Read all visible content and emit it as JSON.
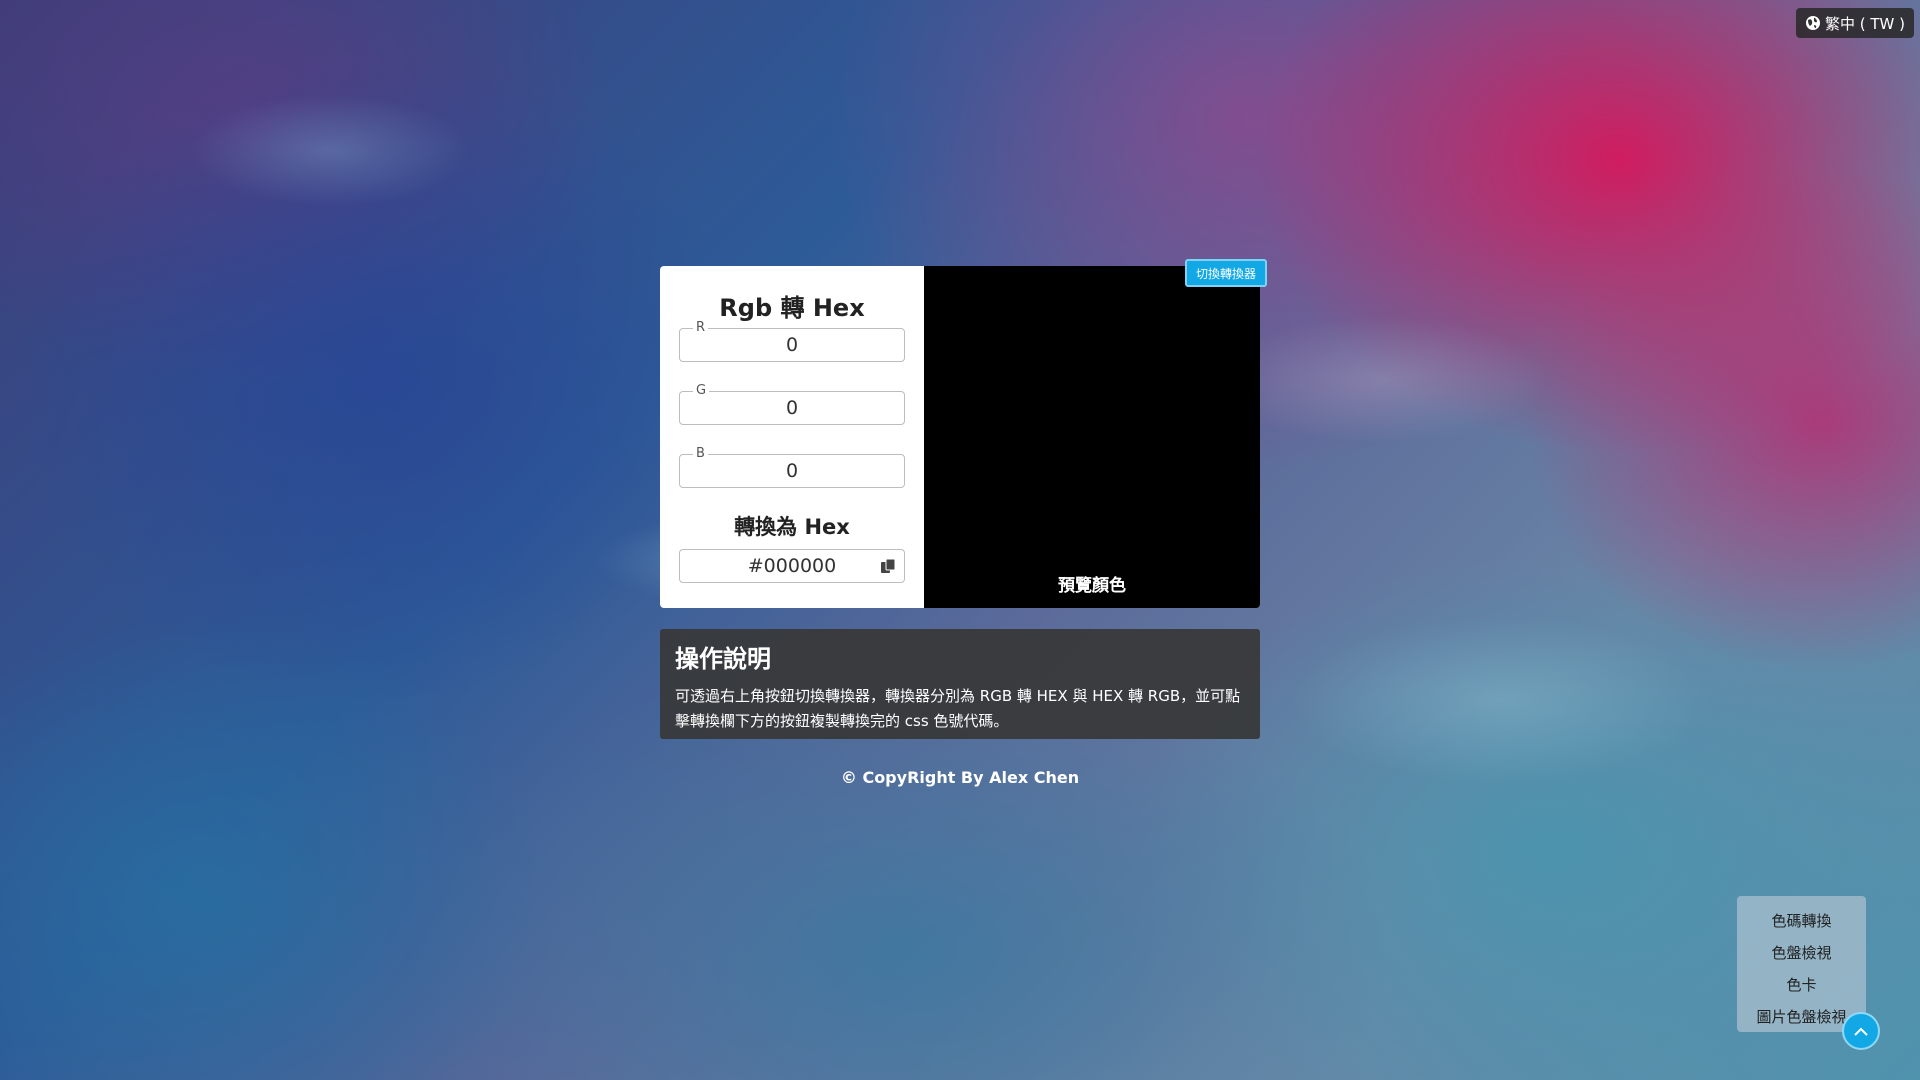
{
  "language": {
    "label": "繁中 ( TW )",
    "icon": "globe-icon"
  },
  "converter": {
    "title": "Rgb 轉 Hex",
    "fields": [
      {
        "label": "R",
        "value": "0"
      },
      {
        "label": "G",
        "value": "0"
      },
      {
        "label": "B",
        "value": "0"
      }
    ],
    "result_title": "轉換為 Hex",
    "result_value": "#000000",
    "copy_icon": "copy-icon",
    "switch_label": "切換轉換器",
    "preview_label": "預覽顏色",
    "preview_color": "#000000"
  },
  "instructions": {
    "title": "操作說明",
    "text": "可透過右上角按鈕切換轉換器，轉換器分別為 RGB 轉 HEX 與 HEX 轉 RGB，並可點擊轉換欄下方的按鈕複製轉換完的 css 色號代碼。"
  },
  "footer": {
    "copyright": "© CopyRight By Alex Chen"
  },
  "menu": {
    "items": [
      "色碼轉換",
      "色盤檢視",
      "色卡",
      "圖片色盤檢視"
    ],
    "toggle_icon": "chevron-up-icon"
  },
  "colors": {
    "accent": "#12a8e6",
    "panel": "#373737"
  }
}
